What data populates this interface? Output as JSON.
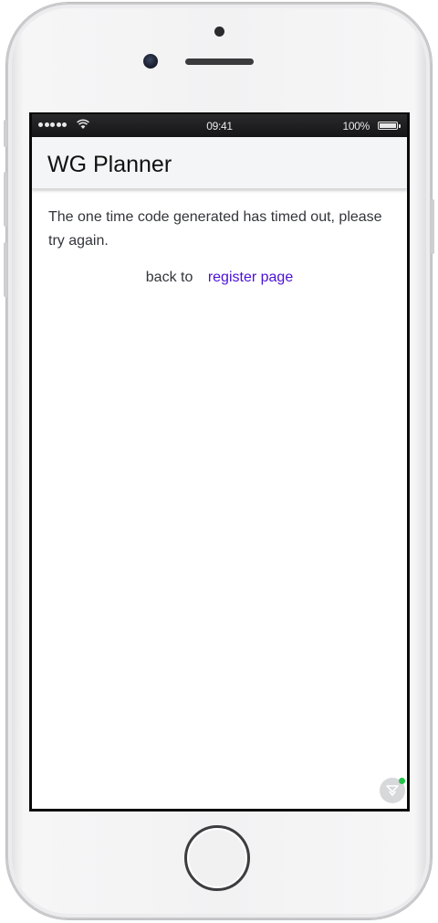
{
  "status_bar": {
    "time": "09:41",
    "battery": "100%",
    "battery_level": 1.0,
    "signal_bars": 5
  },
  "header": {
    "title": "WG Planner"
  },
  "main": {
    "message": "The one time code generated has timed out, please try again.",
    "back_text": "back to",
    "link_label": "register page"
  },
  "colors": {
    "link": "#4a10d8",
    "header_bg": "#f4f5f6",
    "text": "#33353a",
    "float_indicator": "#21c64a"
  },
  "icons": {
    "signal": "signal-dots-icon",
    "wifi": "wifi-icon",
    "battery": "battery-icon",
    "floating": "chevron-down-filter-icon"
  }
}
